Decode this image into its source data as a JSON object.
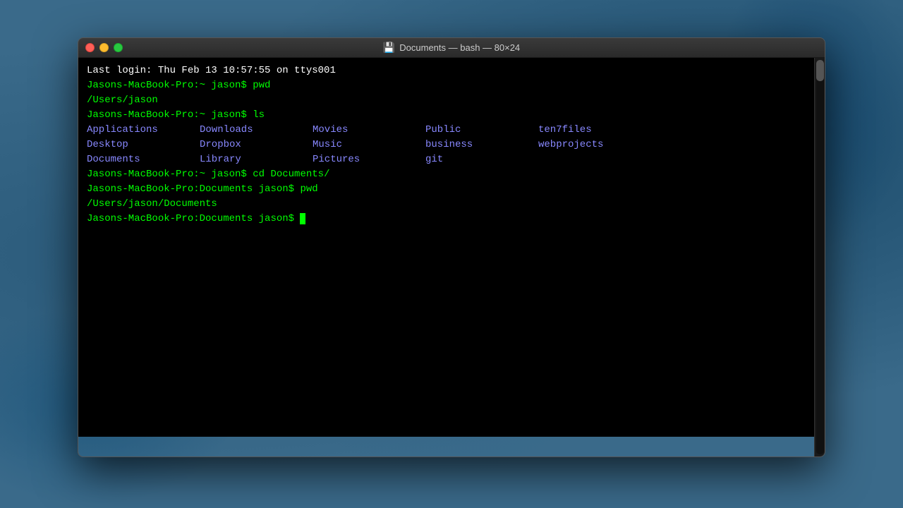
{
  "window": {
    "title": "Documents — bash — 80×24",
    "controls": {
      "close_label": "close",
      "minimize_label": "minimize",
      "maximize_label": "maximize"
    }
  },
  "terminal": {
    "last_login_line": "Last login: Thu Feb 13 10:57:55 on ttys001",
    "prompt1": "Jasons-MacBook-Pro:~ jason$ ",
    "cmd1": "pwd",
    "output1": "/Users/jason",
    "prompt2": "Jasons-MacBook-Pro:~ jason$ ",
    "cmd2": "ls",
    "dir_col1": [
      "Applications",
      "Desktop",
      "Documents"
    ],
    "dir_col2": [
      "Downloads",
      "Dropbox",
      "Library"
    ],
    "dir_col3": [
      "Movies",
      "Music",
      "Pictures"
    ],
    "dir_col4": [
      "Public",
      "business",
      "git"
    ],
    "dir_col5": [
      "ten7files",
      "webprojects",
      ""
    ],
    "prompt3": "Jasons-MacBook-Pro:~ jason$ ",
    "cmd3": "cd Documents/",
    "prompt4": "Jasons-MacBook-Pro:Documents jason$ ",
    "cmd4": "pwd",
    "output4": "/Users/jason/Documents",
    "prompt5": "Jasons-MacBook-Pro:Documents jason$ "
  }
}
